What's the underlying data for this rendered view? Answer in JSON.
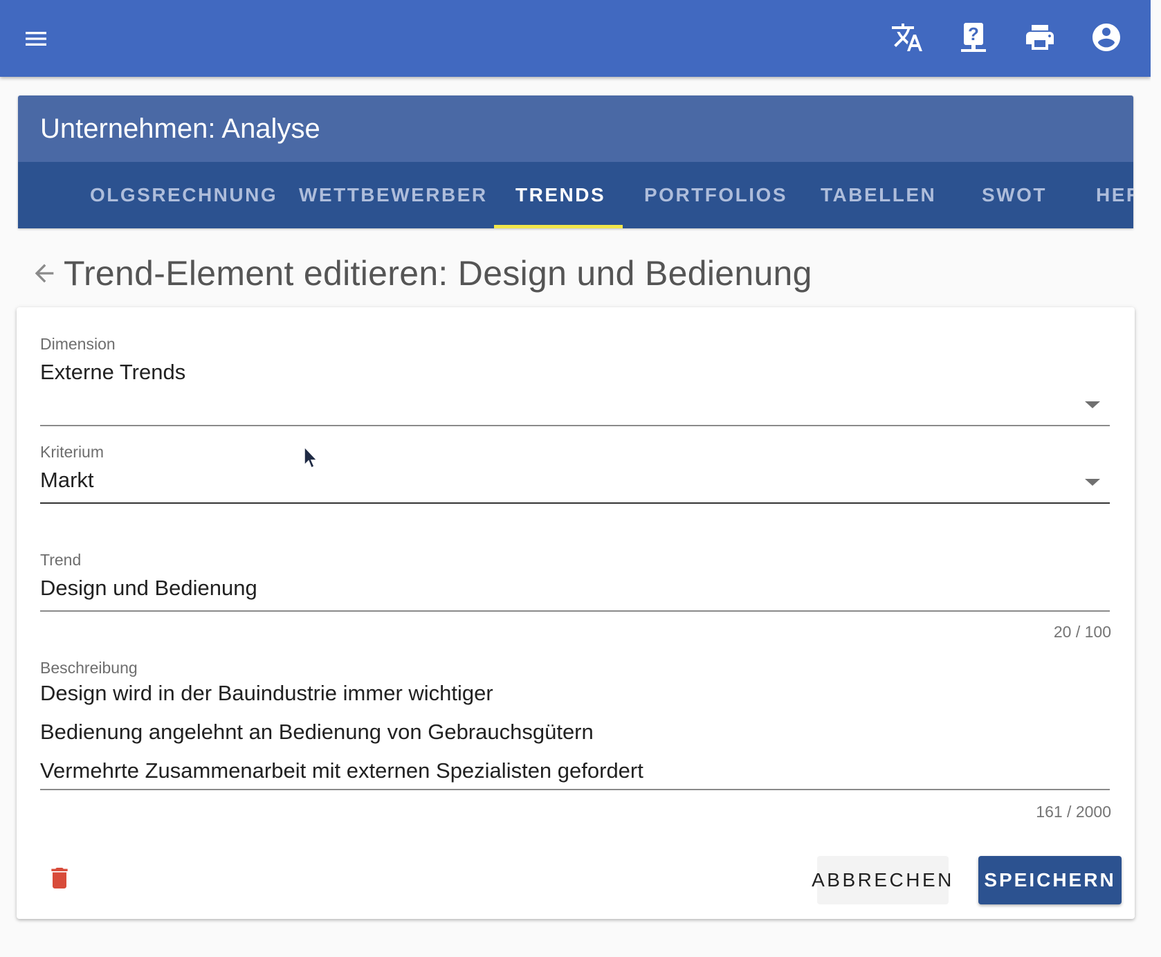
{
  "appbar": {
    "icons": [
      "menu-icon",
      "translate-icon",
      "help-icon",
      "print-icon",
      "account-circle-icon"
    ],
    "color": "#4169c0"
  },
  "header": {
    "title": "Unternehmen: Analyse",
    "title_bg": "#4a69a5"
  },
  "tabs": {
    "items": [
      {
        "label": "ERFOLGSRECHNUNG",
        "visible_text": "OLGSRECHNUNG"
      },
      {
        "label": "WETTBEWERBER"
      },
      {
        "label": "TRENDS",
        "active": true
      },
      {
        "label": "PORTFOLIOS"
      },
      {
        "label": "TABELLEN"
      },
      {
        "label": "SWOT"
      },
      {
        "label": "HER"
      }
    ],
    "indicator_color": "#f1e64a",
    "bg": "#2c5290"
  },
  "page": {
    "title": "Trend-Element editieren: Design und Bedienung"
  },
  "form": {
    "dimension": {
      "label": "Dimension",
      "value": "Externe Trends"
    },
    "kriterium": {
      "label": "Kriterium",
      "value": "Markt"
    },
    "trend": {
      "label": "Trend",
      "value": "Design und Bedienung",
      "counter": "20 / 100"
    },
    "beschreibung": {
      "label": "Beschreibung",
      "lines": [
        "Design wird in der Bauindustrie immer wichtiger",
        "Bedienung angelehnt an Bedienung von Gebrauchsgütern",
        "Vermehrte Zusammenarbeit mit externen Spezialisten gefordert"
      ],
      "counter": "161 / 2000"
    }
  },
  "actions": {
    "cancel_label": "ABBRECHEN",
    "save_label": "SPEICHERN",
    "delete_color": "#d84b3a"
  }
}
